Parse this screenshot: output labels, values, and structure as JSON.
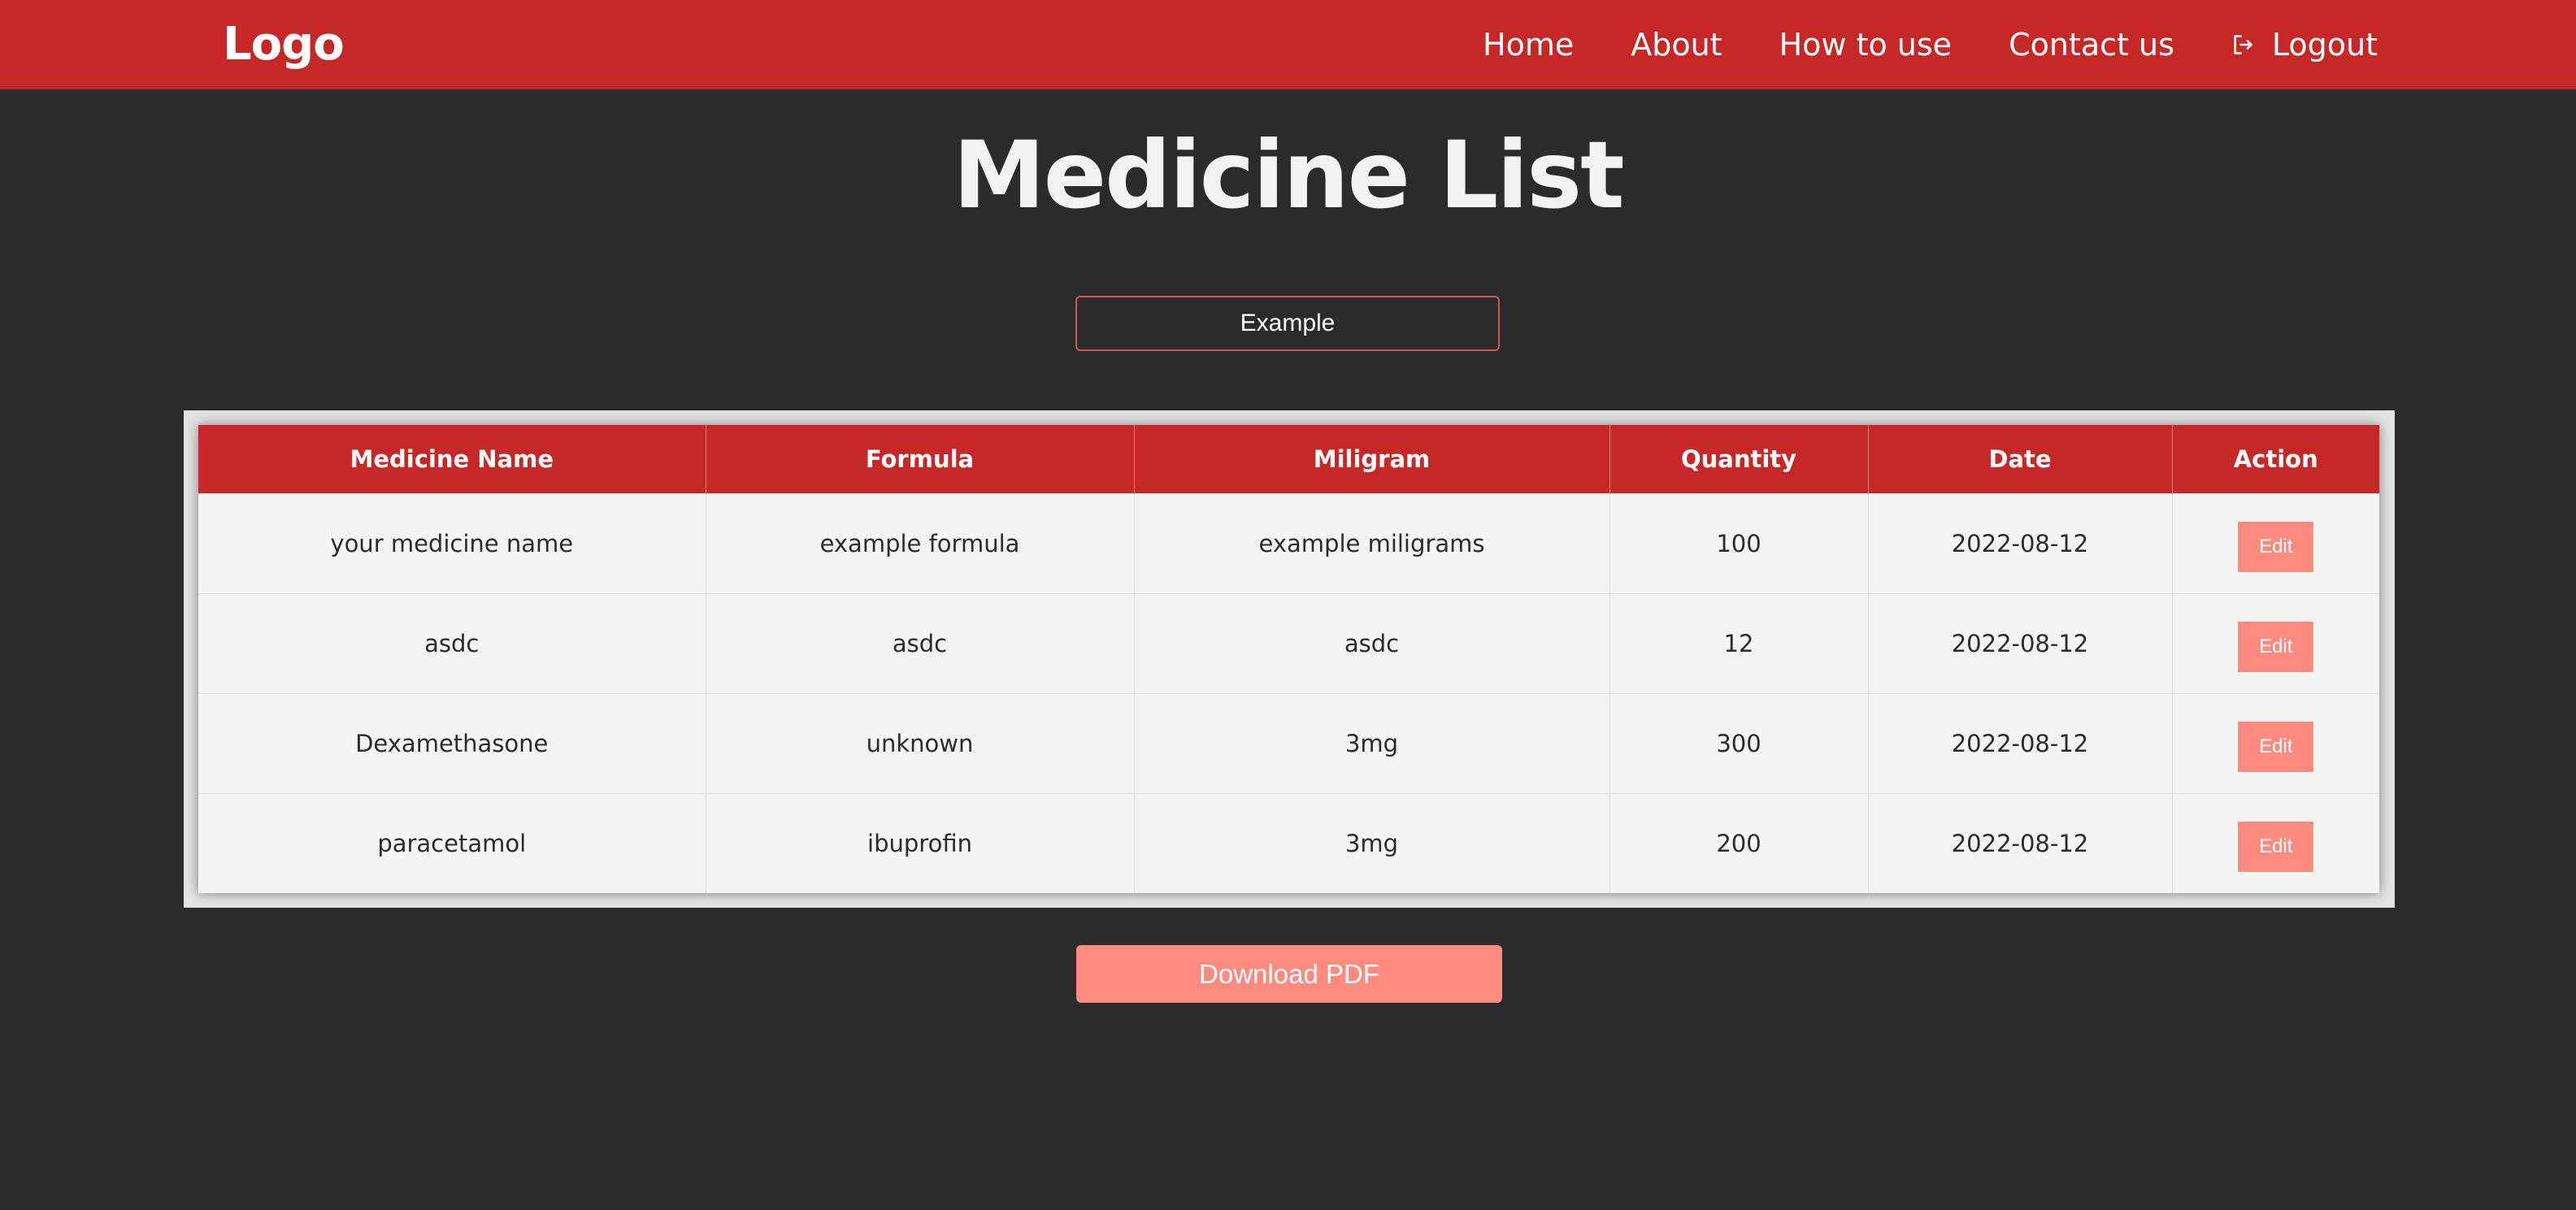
{
  "header": {
    "logo": "Logo",
    "nav": [
      {
        "label": "Home"
      },
      {
        "label": "About"
      },
      {
        "label": "How to use"
      },
      {
        "label": "Contact us"
      }
    ],
    "logout_label": "Logout",
    "logout_icon": "logout-icon",
    "bg_color": "#c62828"
  },
  "main": {
    "title": "Medicine List",
    "search": {
      "placeholder": "Example",
      "border_color": "#d9534f"
    },
    "table": {
      "columns": [
        "Medicine Name",
        "Formula",
        "Miligram",
        "Quantity",
        "Date",
        "Action"
      ],
      "rows": [
        {
          "name": "your medicine name",
          "formula": "example formula",
          "miligram": "example miligrams",
          "quantity": "100",
          "date": "2022-08-12",
          "action": "Edit"
        },
        {
          "name": "asdc",
          "formula": "asdc",
          "miligram": "asdc",
          "quantity": "12",
          "date": "2022-08-12",
          "action": "Edit"
        },
        {
          "name": "Dexamethasone",
          "formula": "unknown",
          "miligram": "3mg",
          "quantity": "300",
          "date": "2022-08-12",
          "action": "Edit"
        },
        {
          "name": "paracetamol",
          "formula": "ibuprofin",
          "miligram": "3mg",
          "quantity": "200",
          "date": "2022-08-12",
          "action": "Edit"
        }
      ]
    },
    "download_label": "Download PDF",
    "accent_color": "#ff8a80",
    "background_color": "#2b2b2b"
  }
}
